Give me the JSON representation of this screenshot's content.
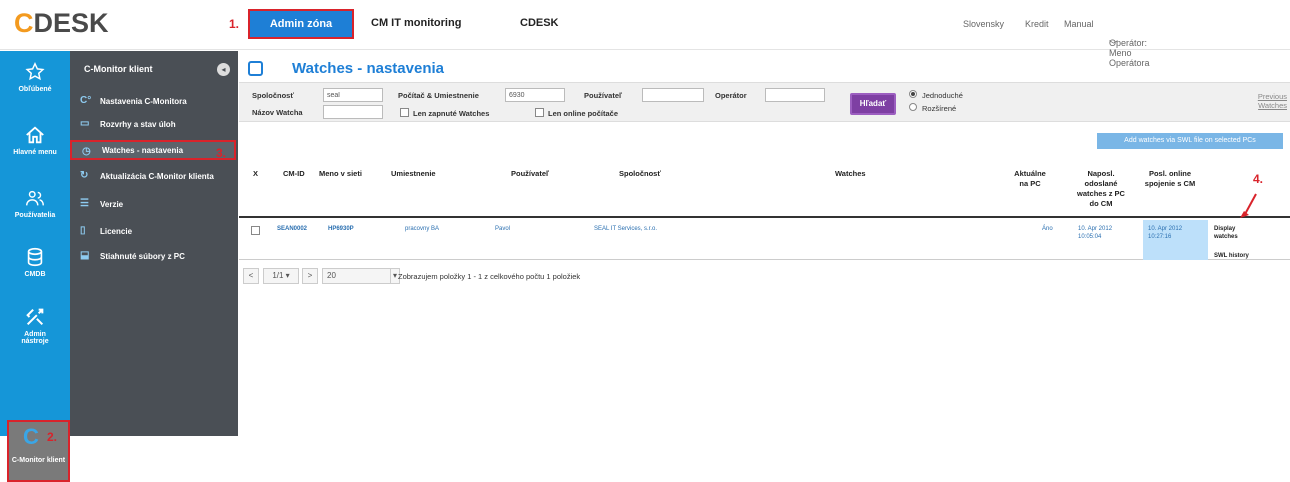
{
  "logo": {
    "text_c": "C",
    "text_rest": "DESK"
  },
  "annotations": {
    "a1": "1.",
    "a2": "2.",
    "a3": "3.",
    "a4": "4."
  },
  "topnav": {
    "admin": "Admin zóna",
    "monitoring": "CM IT monitoring",
    "cdesk": "CDESK"
  },
  "topright": {
    "language": "Slovensky",
    "credit": "Kredit",
    "manual": "Manual",
    "operator": "Operátor: Meno Operátora"
  },
  "rail": [
    {
      "label": "Obľúbené",
      "icon": "star-icon"
    },
    {
      "label": "Hlavné menu",
      "icon": "home-icon"
    },
    {
      "label": "Používatelia",
      "icon": "users-icon"
    },
    {
      "label": "CMDB",
      "icon": "database-icon"
    },
    {
      "label": "Admin nástroje",
      "icon": "tools-icon"
    },
    {
      "label": "C-Monitor klient",
      "icon": "c-logo-icon"
    }
  ],
  "menu": {
    "title": "C-Monitor klient",
    "collapse_glyph": "◂",
    "items": [
      {
        "label": "Nastavenia C-Monitora",
        "icon": "settings-icon"
      },
      {
        "label": "Rozvrhy a stav úloh",
        "icon": "calendar-icon"
      },
      {
        "label": "Watches - nastavenia",
        "icon": "watch-icon"
      },
      {
        "label": "Aktualizácia C-Monitor klienta",
        "icon": "refresh-icon"
      },
      {
        "label": "Verzie",
        "icon": "list-icon"
      },
      {
        "label": "Licencie",
        "icon": "license-icon"
      },
      {
        "label": "Stiahnuté súbory z PC",
        "icon": "download-icon"
      }
    ]
  },
  "page": {
    "title": "Watches - nastavenia"
  },
  "filter": {
    "company_label": "Spoločnosť",
    "company_value": "seal",
    "computer_label": "Počítač & Umiestnenie",
    "computer_value": "6930",
    "user_label": "Používateľ",
    "user_value": "",
    "operator_label": "Operátor",
    "operator_value": "",
    "watch_name_label": "Názov Watcha",
    "watch_name_value": "",
    "only_enabled_label": "Len zapnuté Watches",
    "only_online_label": "Len online počítače",
    "search_button": "Hľadať",
    "mode_simple": "Jednoduché",
    "mode_advanced": "Rozšírené",
    "previous_watches": "Previous Watches"
  },
  "add_swl_button": "Add watches via SWL file on selected PCs",
  "table": {
    "headers": [
      "X",
      "CM-ID",
      "Meno v sieti",
      "Umiestnenie",
      "Používateľ",
      "Spoločnosť",
      "Watches",
      "Aktuálne na PC",
      "Naposl. odoslané watches z PC do CM",
      "Posl. online spojenie s CM",
      ""
    ],
    "rows": [
      {
        "cmid": "SEAN0002",
        "name": "HP6930P",
        "location": "pracovny BA",
        "user": "Pavol",
        "company": "SEAL IT Services, s.r.o.",
        "watches": "",
        "current": "Áno",
        "last_sent": "10. Apr 2012 10:05:04",
        "last_online": "10. Apr 2012 10:27:16",
        "action1": "Display watches",
        "action2": "SWL history"
      }
    ]
  },
  "pager": {
    "first": "<",
    "page": "1/1",
    "next": ">",
    "page_size": "20",
    "status": "Zobrazujem položky 1 - 1 z celkového počtu 1 položiek"
  }
}
